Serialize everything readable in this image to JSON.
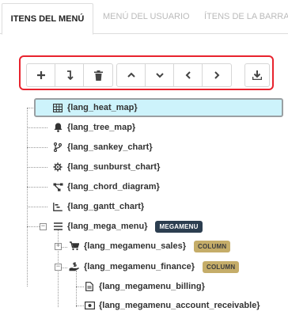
{
  "tabs": [
    {
      "label": "ITENS DEL MENÚ",
      "active": true
    },
    {
      "label": "MENÚ DEL USUARIO",
      "active": false
    },
    {
      "label": "ÍTENS DE LA BARRA",
      "active": false
    }
  ],
  "toolbar": {
    "buttons": [
      {
        "icon": "plus-icon",
        "action": "add"
      },
      {
        "icon": "indent-arrow-icon",
        "action": "insert-child"
      },
      {
        "icon": "trash-icon",
        "action": "delete"
      },
      {
        "icon": "chevron-up-icon",
        "action": "move-up"
      },
      {
        "icon": "chevron-down-icon",
        "action": "move-down"
      },
      {
        "icon": "chevron-left-icon",
        "action": "outdent"
      },
      {
        "icon": "chevron-right-icon",
        "action": "indent"
      },
      {
        "icon": "download-icon",
        "action": "save"
      }
    ],
    "highlight_color": "#e8232e"
  },
  "tree": {
    "items": [
      {
        "label": "{lang_heat_map}",
        "icon": "table-icon",
        "selected": true
      },
      {
        "label": "{lang_tree_map}",
        "icon": "bell-icon"
      },
      {
        "label": "{lang_sankey_chart}",
        "icon": "code-branch-icon"
      },
      {
        "label": "{lang_sunburst_chart}",
        "icon": "gear-icon"
      },
      {
        "label": "{lang_chord_diagram}",
        "icon": "share-nodes-icon"
      },
      {
        "label": "{lang_gantt_chart}",
        "icon": "gantt-chart-icon"
      },
      {
        "label": "{lang_mega_menu}",
        "icon": "bars-icon",
        "expanded": true,
        "badge": "MEGAMENU"
      },
      {
        "label": "{lang_megamenu_sales}",
        "icon": "cart-icon",
        "expanded": false,
        "badge": "COLUMN"
      },
      {
        "label": "{lang_megamenu_finance}",
        "icon": "hand-dollar-icon",
        "expanded": true,
        "badge": "COLUMN"
      },
      {
        "label": "{lang_megamenu_billing}",
        "icon": "file-icon"
      },
      {
        "label": "{lang_megamenu_account_receivable}",
        "icon": "money-icon"
      }
    ]
  },
  "colors": {
    "selected_bg": "#cdf3fb",
    "badge_megamenu": "#2c3e50",
    "badge_column": "#c5ad69"
  }
}
